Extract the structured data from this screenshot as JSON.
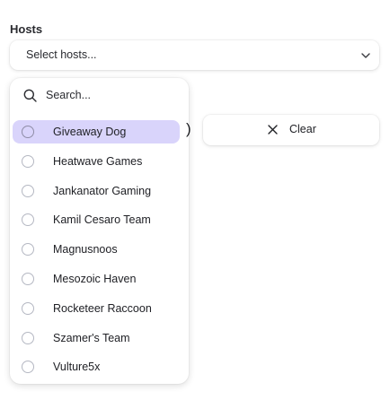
{
  "field": {
    "label": "Hosts"
  },
  "select": {
    "placeholder": "Select hosts..."
  },
  "search": {
    "placeholder": "Search..."
  },
  "options": [
    {
      "label": "Giveaway Dog",
      "highlighted": true
    },
    {
      "label": "Heatwave Games"
    },
    {
      "label": "Jankanator Gaming"
    },
    {
      "label": "Kamil Cesaro Team"
    },
    {
      "label": "Magnusnoos"
    },
    {
      "label": "Mesozoic Haven"
    },
    {
      "label": "Rocketeer Raccoon"
    },
    {
      "label": "Szamer's Team"
    },
    {
      "label": "Vulture5x"
    }
  ],
  "stray_text": ")",
  "clear_button": {
    "label": "Clear",
    "icon": "close-icon"
  },
  "colors": {
    "highlight": "#d9d4fb",
    "text": "#202126"
  },
  "icons": {
    "search": "search-icon",
    "chevron": "chevron-down-icon",
    "radio": "radio-unchecked-icon"
  }
}
